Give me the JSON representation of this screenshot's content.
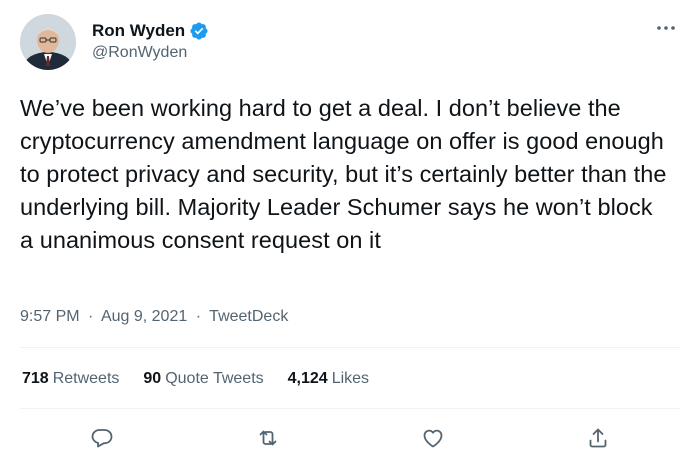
{
  "author": {
    "display_name": "Ron Wyden",
    "handle": "@RonWyden",
    "verified": true
  },
  "tweet": {
    "text": "We’ve been working hard to get a deal. I don’t believe the cryptocurrency amendment language on offer is good enough to protect privacy and security, but it’s certainly better than the underlying bill. Majority Leader Schumer says he won’t block a unanimous consent request on it",
    "time": "9:57 PM",
    "separator": "·",
    "date": "Aug 9, 2021",
    "source": "TweetDeck"
  },
  "stats": {
    "retweets": {
      "count": "718",
      "label": "Retweets"
    },
    "quotes": {
      "count": "90",
      "label": "Quote Tweets"
    },
    "likes": {
      "count": "4,124",
      "label": "Likes"
    }
  },
  "icons": {
    "verified": "verified-badge-icon",
    "more": "more-options-icon",
    "reply": "reply-icon",
    "retweet": "retweet-icon",
    "like": "heart-icon",
    "share": "share-icon"
  },
  "colors": {
    "verified_blue": "#1d9bf0",
    "text_primary": "#0f1419",
    "text_secondary": "#536471",
    "divider": "#eff3f4"
  }
}
